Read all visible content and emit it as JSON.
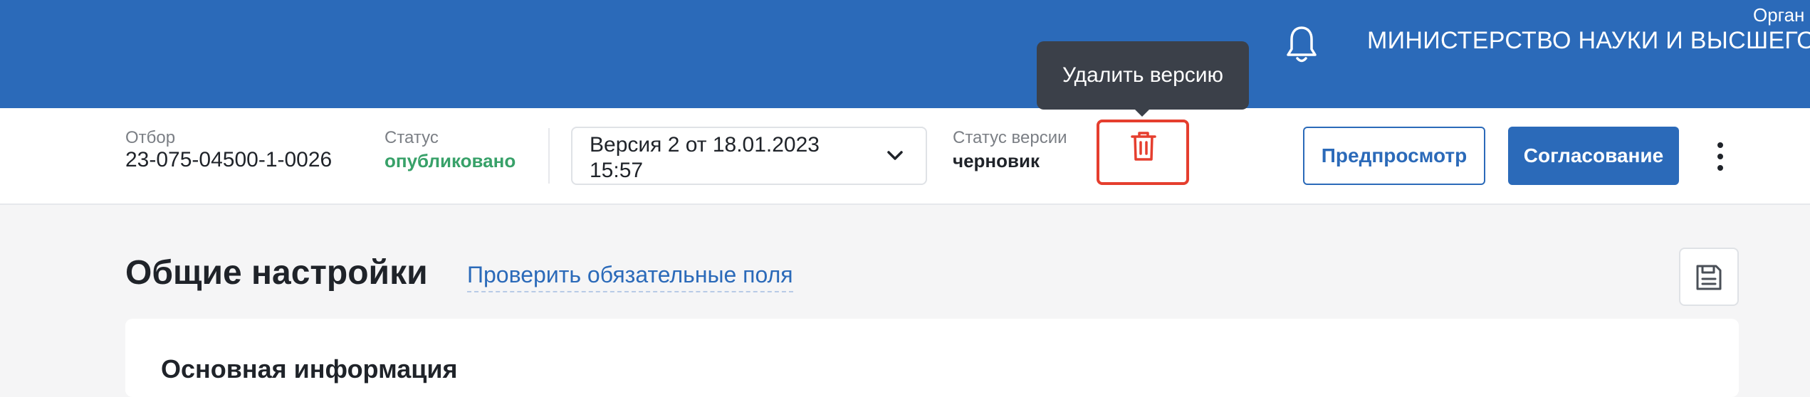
{
  "header": {
    "org_label": "Орган",
    "org_name": "МИНИСТЕРСТВО НАУКИ И ВЫСШЕГО О",
    "bell_icon": "bell-icon",
    "bg_color": "#2b6ab9"
  },
  "toolbar": {
    "selection_label": "Отбор",
    "selection_value": "23-075-04500-1-0026",
    "status_label": "Статус",
    "status_value": "опубликовано",
    "version_select": "Версия 2 от 18.01.2023 15:57",
    "version_status_label": "Статус версии",
    "version_status_value": "черновик",
    "delete_tooltip": "Удалить версию",
    "preview_button": "Предпросмотр",
    "approval_button": "Согласование"
  },
  "main": {
    "title": "Общие настройки",
    "check_link": "Проверить обязательные поля",
    "card_title": "Основная информация"
  },
  "colors": {
    "accent": "#2b6ab9",
    "status_green": "#38a169",
    "delete_red": "#e53e2e"
  }
}
